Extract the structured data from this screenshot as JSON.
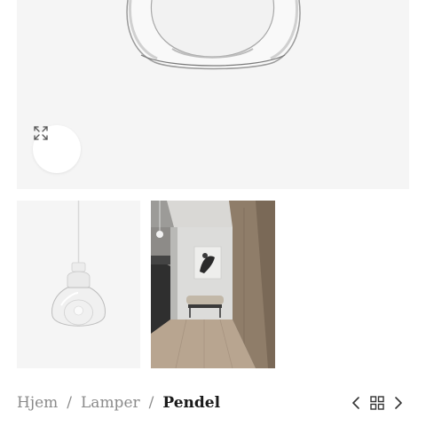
{
  "gallery": {
    "zoom_icon": "expand-arrows-icon",
    "thumbnails": [
      "pendant-lamp-product",
      "interior-hallway-scene"
    ]
  },
  "breadcrumb": {
    "items": [
      "Hjem",
      "Lamper"
    ],
    "current": "Pendel",
    "separator": "/"
  },
  "pager": {
    "prev_icon": "chevron-left-icon",
    "grid_icon": "grid-icon",
    "next_icon": "chevron-right-icon"
  }
}
